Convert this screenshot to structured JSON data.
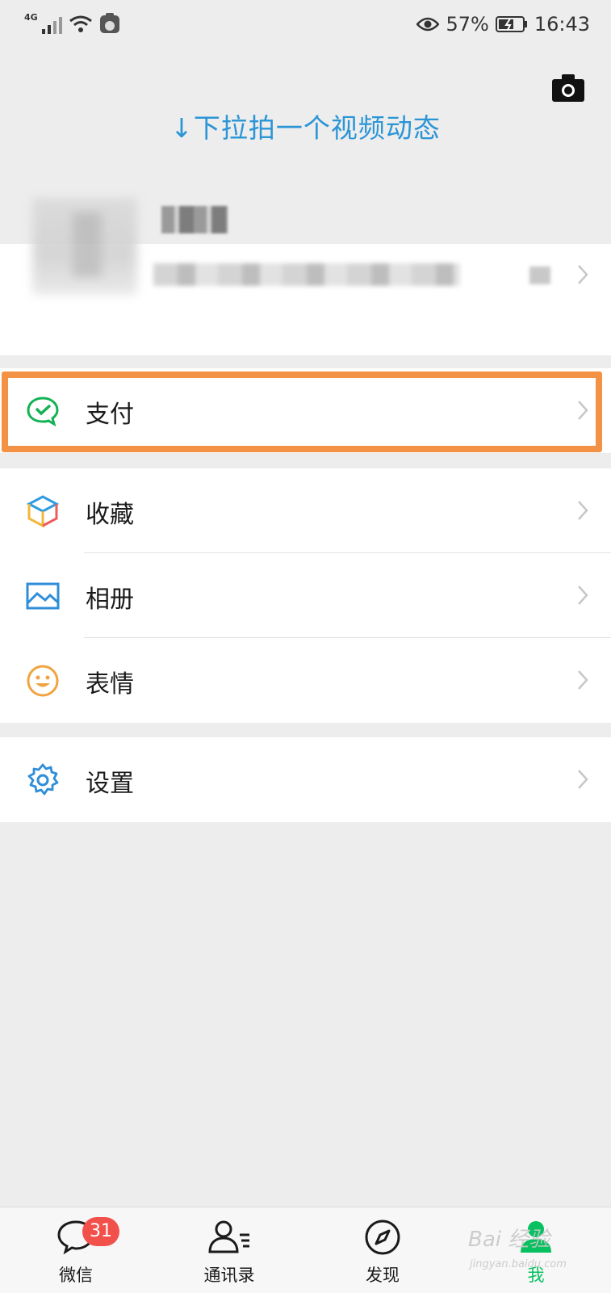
{
  "status_bar": {
    "network": "4G",
    "battery": "57%",
    "time": "16:43"
  },
  "pull_hint": "↓下拉拍一个视频动态",
  "menu": {
    "pay": "支付",
    "favorites": "收藏",
    "album": "相册",
    "stickers": "表情",
    "settings": "设置"
  },
  "tabs": {
    "chats": "微信",
    "contacts": "通讯录",
    "discover": "发现",
    "me": "我"
  },
  "chats_badge": "31",
  "watermark": {
    "main": "Bai 经验",
    "sub": "jingyan.baidu.com"
  },
  "colors": {
    "accent_green": "#07c160",
    "hint_blue": "#2b95d6",
    "highlight_orange": "#f39245",
    "badge_red": "#f2504b"
  }
}
